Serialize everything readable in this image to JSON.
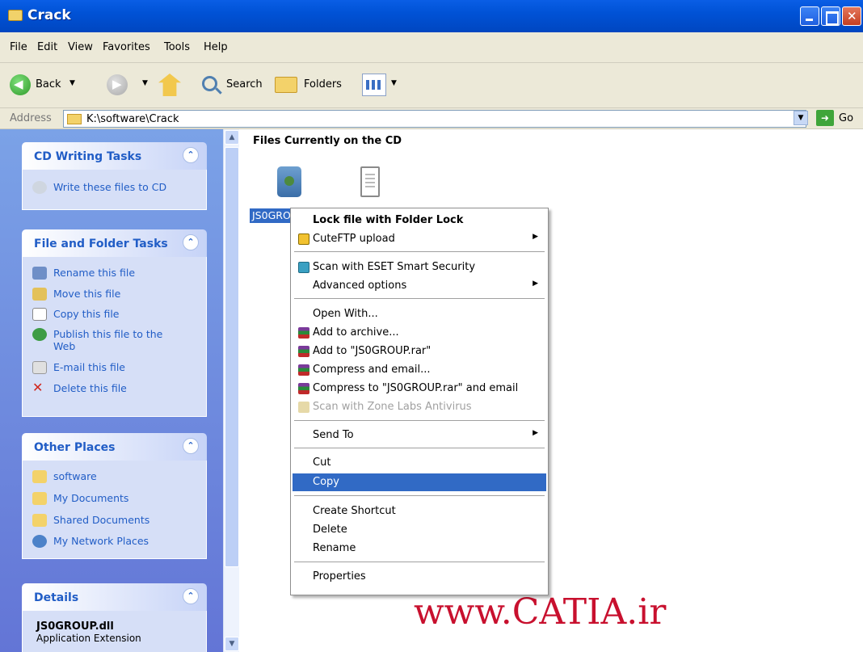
{
  "window": {
    "title": "Crack"
  },
  "menubar": {
    "items": [
      "File",
      "Edit",
      "View",
      "Favorites",
      "Tools",
      "Help"
    ]
  },
  "toolbar": {
    "back_label": "Back",
    "search_label": "Search",
    "folders_label": "Folders"
  },
  "address": {
    "label": "Address",
    "value": "K:\\software\\Crack",
    "go_label": "Go"
  },
  "sidebar": {
    "cd_tasks": {
      "title": "CD Writing Tasks",
      "items": [
        "Write these files to CD"
      ]
    },
    "file_tasks": {
      "title": "File and Folder Tasks",
      "items": [
        "Rename this file",
        "Move this file",
        "Copy this file",
        "Publish this file to the Web",
        "E-mail this file",
        "Delete this file"
      ]
    },
    "other_places": {
      "title": "Other Places",
      "items": [
        "software",
        "My Documents",
        "Shared Documents",
        "My Network Places"
      ]
    },
    "details": {
      "title": "Details",
      "name": "JS0GROUP.dll",
      "type": "Application Extension"
    }
  },
  "content": {
    "heading": "Files Currently on the CD",
    "file1_label": "JS0GROUP.dll"
  },
  "context_menu": {
    "items": [
      "Lock file with Folder Lock",
      "CuteFTP upload",
      "Scan with ESET Smart Security",
      "Advanced options",
      "Open With...",
      "Add to archive...",
      "Add to \"JS0GROUP.rar\"",
      "Compress and email...",
      "Compress to \"JS0GROUP.rar\" and email",
      "Scan with Zone Labs Antivirus",
      "Send To",
      "Cut",
      "Copy",
      "Create Shortcut",
      "Delete",
      "Rename",
      "Properties"
    ],
    "highlighted": "Copy",
    "disabled": "Scan with Zone Labs Antivirus"
  },
  "watermark": "www.CATIA.ir",
  "icons": [
    "folder-icon",
    "back-icon",
    "forward-icon",
    "up-icon",
    "search-icon",
    "folders-icon",
    "views-icon",
    "go-icon",
    "chevron-up-icon"
  ]
}
